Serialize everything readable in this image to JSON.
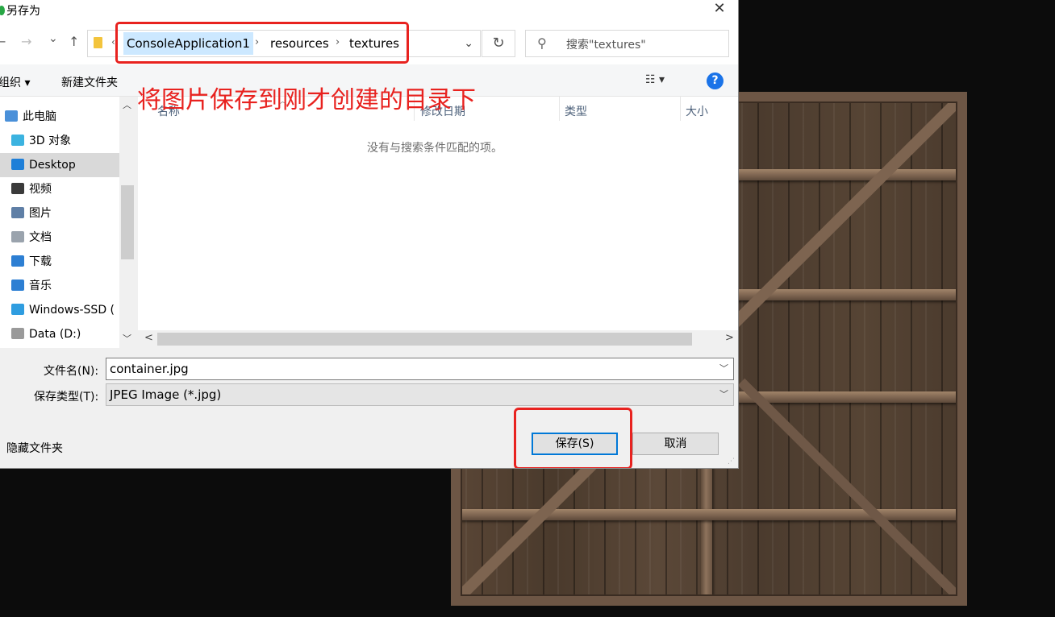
{
  "dialog": {
    "title": "另存为",
    "close_glyph": "✕"
  },
  "nav": {
    "back_glyph": "←",
    "forward_glyph": "→",
    "recent_glyph": "⌄",
    "up_glyph": "↑"
  },
  "breadcrumb": {
    "items": [
      "ConsoleApplication1",
      "resources",
      "textures"
    ],
    "separator": "›",
    "overflow_glyph": "‹"
  },
  "search": {
    "placeholder": "搜索\"textures\""
  },
  "toolbar": {
    "organize_label": "组织 ▾",
    "new_folder_label": "新建文件夹",
    "view_label": "☷ ▾",
    "help_label": "?"
  },
  "sidebar": {
    "items": [
      {
        "label": "此电脑",
        "icon": "computer-icon",
        "color": "#4a90d9"
      },
      {
        "label": "3D 对象",
        "icon": "cube-3d-icon",
        "color": "#3bb3e0"
      },
      {
        "label": "Desktop",
        "icon": "desktop-icon",
        "color": "#1e7fd8"
      },
      {
        "label": "视频",
        "icon": "video-icon",
        "color": "#3a3a3a"
      },
      {
        "label": "图片",
        "icon": "pictures-icon",
        "color": "#5f7fa6"
      },
      {
        "label": "文档",
        "icon": "documents-icon",
        "color": "#9aa3ad"
      },
      {
        "label": "下载",
        "icon": "download-icon",
        "color": "#2d7fd3"
      },
      {
        "label": "音乐",
        "icon": "music-icon",
        "color": "#2d7fd3"
      },
      {
        "label": "Windows-SSD (",
        "icon": "windows-drive-icon",
        "color": "#2f9de0"
      },
      {
        "label": "Data (D:)",
        "icon": "drive-icon",
        "color": "#9a9a9a"
      }
    ],
    "selected_index": 2
  },
  "file_list": {
    "columns": [
      "名称",
      "修改日期",
      "类型",
      "大小"
    ],
    "empty_message": "没有与搜索条件匹配的项。"
  },
  "annotation": {
    "text": "将图片保存到刚才创建的目录下",
    "color": "#e8221f"
  },
  "form": {
    "filename_label": "文件名(N):",
    "filename_value": "container.jpg",
    "filetype_label": "保存类型(T):",
    "filetype_value": "JPEG Image (*.jpg)"
  },
  "footer": {
    "hide_folders_label": "隐藏文件夹",
    "save_label": "保存(S)",
    "cancel_label": "取消"
  }
}
